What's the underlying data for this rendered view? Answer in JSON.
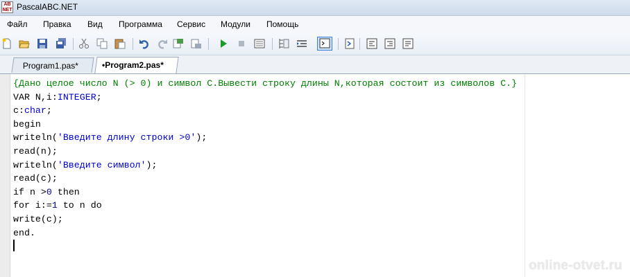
{
  "window": {
    "title": "PascalABC.NET",
    "icon_text": [
      "AB",
      "NET"
    ]
  },
  "menu": [
    "Файл",
    "Правка",
    "Вид",
    "Программа",
    "Сервис",
    "Модули",
    "Помощь"
  ],
  "toolbar": {
    "buttons": [
      "new-file-icon",
      "open-folder-icon",
      "save-icon",
      "save-all-icon",
      "cut-icon",
      "copy-icon",
      "paste-icon",
      "undo-icon",
      "redo-icon",
      "find-icon",
      "replace-icon",
      "run-icon",
      "stop-icon",
      "debug-icon",
      "format-icon",
      "indent-icon",
      "output-window-icon",
      "module-icon",
      "step-into-icon",
      "step-over-icon",
      "run-to-cursor-icon"
    ]
  },
  "tabs": [
    {
      "label": "Program1.pas*",
      "active": false
    },
    {
      "label": "•Program2.pas*",
      "active": true
    }
  ],
  "editor": {
    "lines": [
      [
        {
          "t": "{Дано целое число N (> 0) и символ C.Вывести строку длины N,которая состоит из символов C.}",
          "k": "comment"
        }
      ],
      [
        {
          "t": "VAR N,i:",
          "k": "plain"
        },
        {
          "t": "INTEGER",
          "k": "type"
        },
        {
          "t": ";",
          "k": "plain"
        }
      ],
      [
        {
          "t": "c:",
          "k": "plain"
        },
        {
          "t": "char",
          "k": "type"
        },
        {
          "t": ";",
          "k": "plain"
        }
      ],
      [
        {
          "t": "begin",
          "k": "plain"
        }
      ],
      [
        {
          "t": "writeln(",
          "k": "plain"
        },
        {
          "t": "'Введите длину строки >0'",
          "k": "str"
        },
        {
          "t": ");",
          "k": "plain"
        }
      ],
      [
        {
          "t": "read(n);",
          "k": "plain"
        }
      ],
      [
        {
          "t": "writeln(",
          "k": "plain"
        },
        {
          "t": "'Введите символ'",
          "k": "str"
        },
        {
          "t": ");",
          "k": "plain"
        }
      ],
      [
        {
          "t": "read(c);",
          "k": "plain"
        }
      ],
      [
        {
          "t": "if n >",
          "k": "plain"
        },
        {
          "t": "0",
          "k": "num"
        },
        {
          "t": " then",
          "k": "plain"
        }
      ],
      [
        {
          "t": "for i:=",
          "k": "plain"
        },
        {
          "t": "1",
          "k": "num"
        },
        {
          "t": " to n do",
          "k": "plain"
        }
      ],
      [
        {
          "t": "write(c);",
          "k": "plain"
        }
      ],
      [
        {
          "t": "end.",
          "k": "plain"
        }
      ]
    ]
  },
  "watermark": "online-otvet.ru"
}
